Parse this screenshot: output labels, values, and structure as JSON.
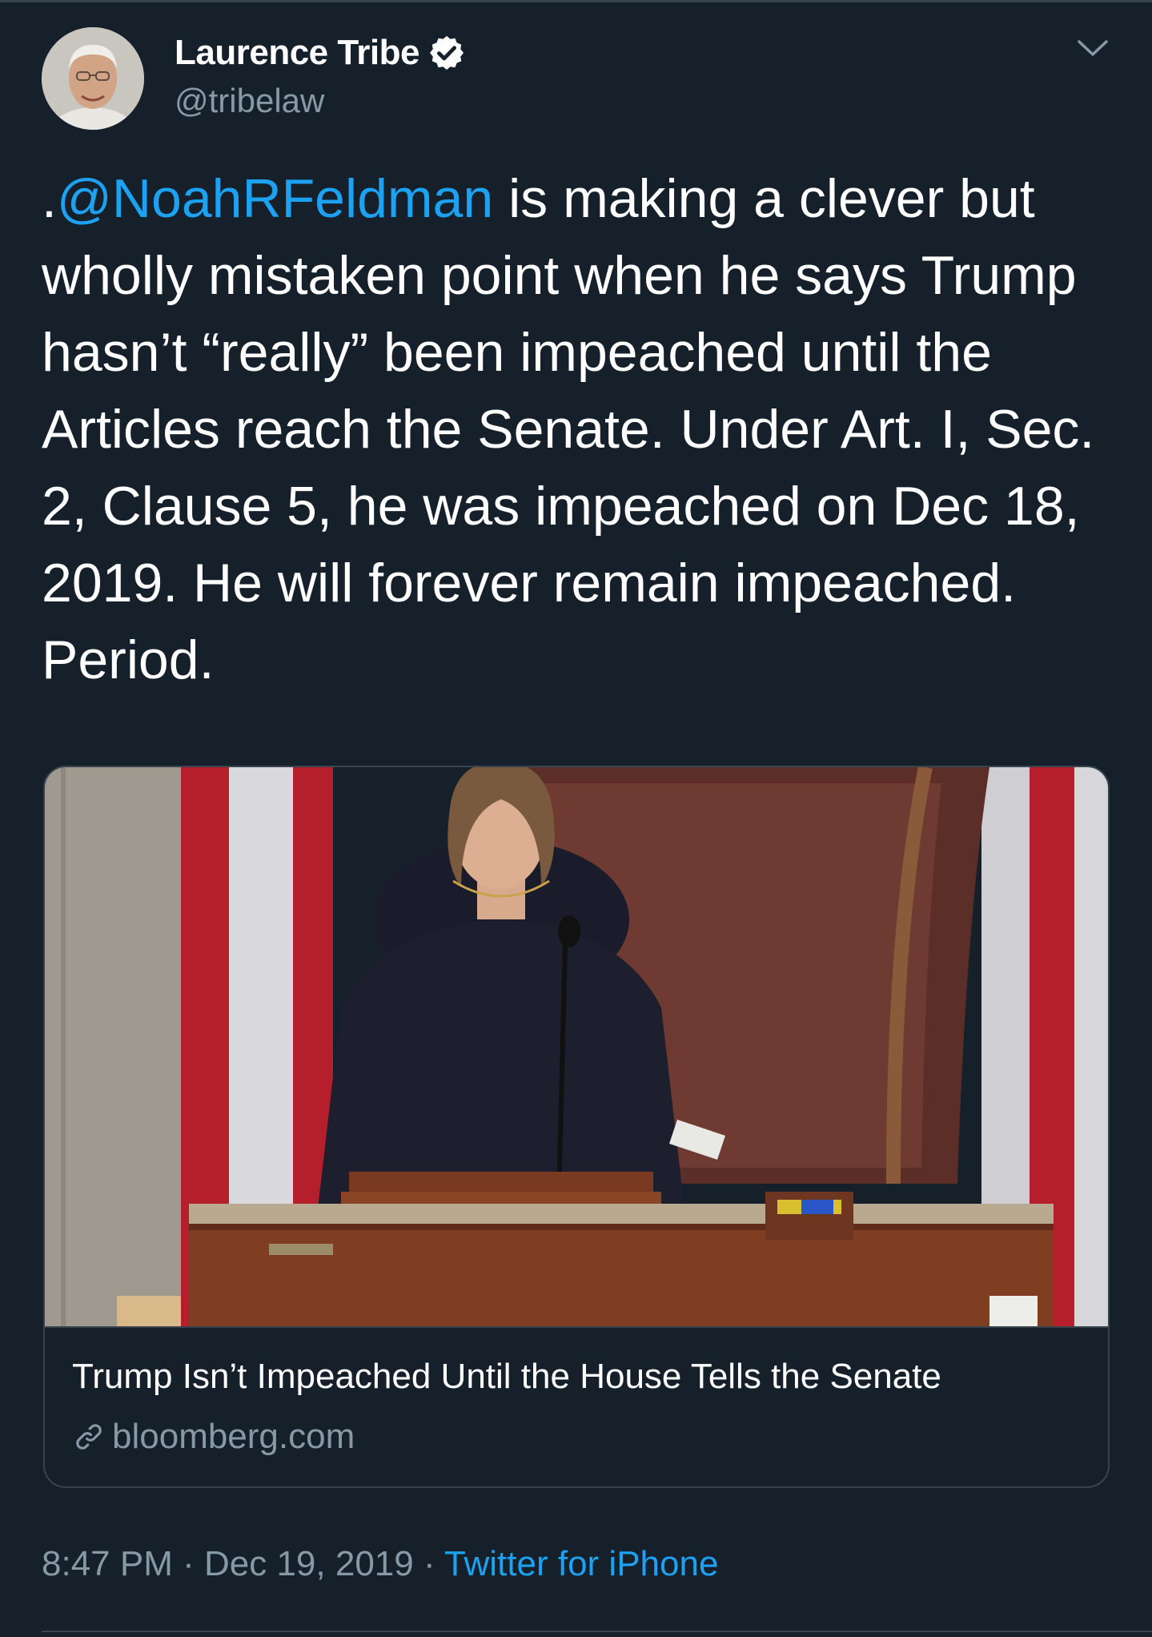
{
  "author": {
    "name": "Laurence Tribe",
    "handle": "@tribelaw",
    "verified": true
  },
  "icons": {
    "verified": "verified-badge-icon",
    "menu": "chevron-down-icon",
    "link": "link-icon"
  },
  "tweet": {
    "prefix": ".",
    "mention": "@NoahRFeldman",
    "body": " is making a clever but wholly mistaken point when he says Trump hasn’t “really” been impeached until the Articles reach the Senate. Under Art. I, Sec. 2, Clause 5, he was impeached on Dec 18, 2019. He will forever remain impeached. Period."
  },
  "card": {
    "title": "Trump Isn’t Impeached Until the House Tells the Senate",
    "domain": "bloomberg.com"
  },
  "meta": {
    "time": "8:47 PM",
    "separator1": " · ",
    "date": "Dec 19, 2019",
    "separator2": " · ",
    "source": "Twitter for iPhone"
  },
  "colors": {
    "background": "#15202b",
    "link": "#1da1f2",
    "secondary_text": "#8899a6",
    "border": "#38444d"
  }
}
